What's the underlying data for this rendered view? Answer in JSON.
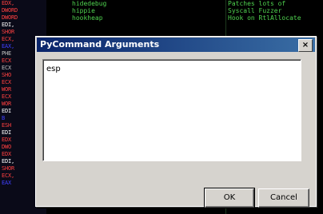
{
  "background": {
    "left_lines": [
      {
        "text": "EDX,",
        "color": "#ff4040"
      },
      {
        "text": "DWORD",
        "color": "#ff4040"
      },
      {
        "text": "DWORD",
        "color": "#ff4040"
      },
      {
        "text": "EDI,",
        "color": "#ffffff"
      },
      {
        "text": "SHOR",
        "color": "#ff4040"
      },
      {
        "text": "ECX,",
        "color": "#ff4040"
      },
      {
        "text": "EAX,",
        "color": "#4040ff"
      },
      {
        "text": "PHE",
        "color": "#c0c0c0"
      },
      {
        "text": "ECX",
        "color": "#ff4040"
      },
      {
        "text": "ECX",
        "color": "#c0c0c0"
      },
      {
        "text": "SHO",
        "color": "#ff4040"
      },
      {
        "text": "ECX",
        "color": "#ff4040"
      },
      {
        "text": "WOR",
        "color": "#ff4040"
      },
      {
        "text": "ECX",
        "color": "#ff4040"
      },
      {
        "text": "WOR",
        "color": "#ff4040"
      },
      {
        "text": "EDI",
        "color": "#ffffff"
      },
      {
        "text": "B",
        "color": "#4040ff"
      },
      {
        "text": "ESH",
        "color": "#ff4040"
      },
      {
        "text": "EDI",
        "color": "#ffffff"
      },
      {
        "text": "EDX",
        "color": "#ff4040"
      },
      {
        "text": "DWO",
        "color": "#ff4040"
      },
      {
        "text": "EDX",
        "color": "#ff4040"
      },
      {
        "text": "EDI,",
        "color": "#ffffff"
      },
      {
        "text": "SHOR",
        "color": "#ff4040"
      },
      {
        "text": "ECX,",
        "color": "#ff4040"
      },
      {
        "text": "EAX",
        "color": "#4040ff"
      }
    ],
    "mid_lines": [
      "hidedebug",
      "hippie",
      "hookheap"
    ],
    "right_lines": [
      "Patches lots of",
      "Syscall Fuzzer",
      "Hook on RtlAllocate"
    ]
  },
  "dialog": {
    "title": "PyCommand Arguments",
    "close_glyph": "×",
    "input_value": "esp",
    "ok_label": "OK",
    "cancel_label": "Cancel"
  }
}
